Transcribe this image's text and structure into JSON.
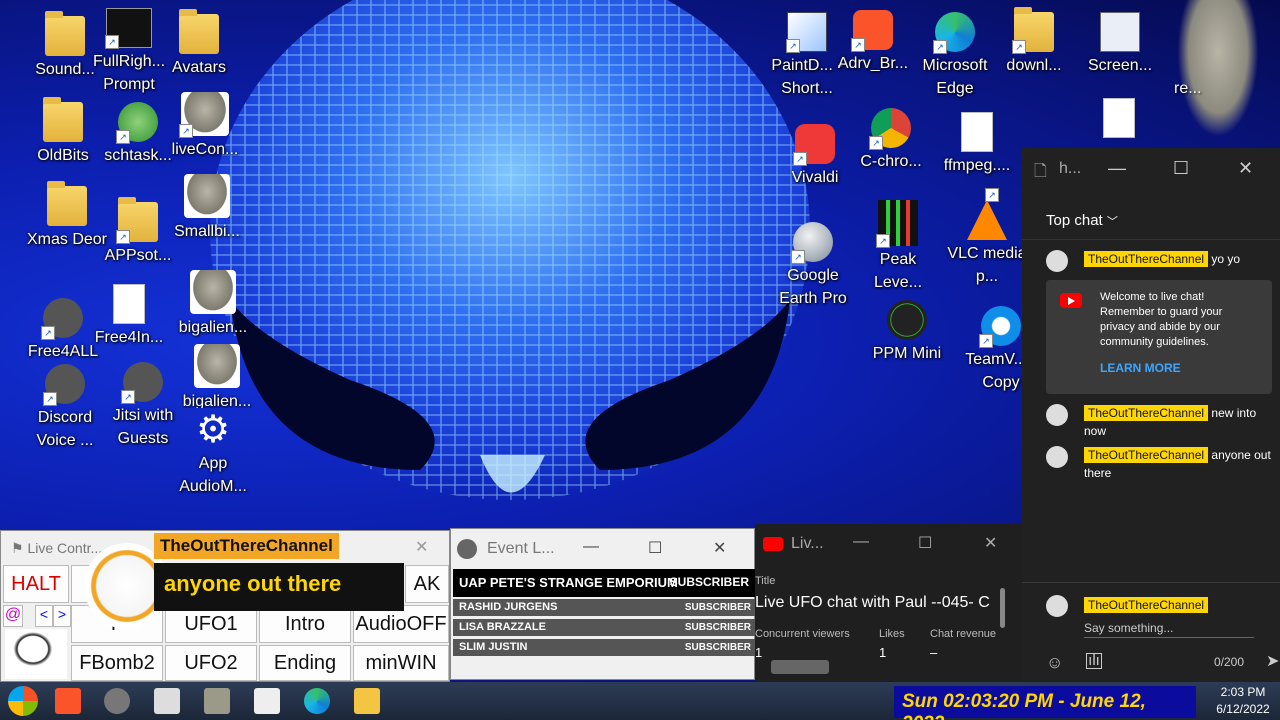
{
  "desktop_icons": [
    {
      "label": "Sound...",
      "icon": "folder-icon"
    },
    {
      "label": "FullRigh... Prompt",
      "icon": "command-prompt-icon"
    },
    {
      "label": "Avatars",
      "icon": "folder-icon"
    },
    {
      "label": "OldBits",
      "icon": "folder-icon"
    },
    {
      "label": "schtask...",
      "icon": "task-scheduler-icon"
    },
    {
      "label": "liveCon...",
      "icon": "alien-shield-icon"
    },
    {
      "label": "Xmas Deor",
      "icon": "folder-icon"
    },
    {
      "label": "APPsot...",
      "icon": "folder-icon"
    },
    {
      "label": "Smallbi...",
      "icon": "alien-image-icon"
    },
    {
      "label": "Free4ALL",
      "icon": "brave-link-icon"
    },
    {
      "label": "Free4In...",
      "icon": "file-icon"
    },
    {
      "label": "bigalien...",
      "icon": "alien-image-icon"
    },
    {
      "label": "Discord Voice ...",
      "icon": "brave-link-icon"
    },
    {
      "label": "Jitsi with Guests",
      "icon": "brave-link-icon"
    },
    {
      "label": "bigalien...",
      "icon": "alien-image-icon"
    },
    {
      "label": "App AudioM...",
      "icon": "gear-icon"
    },
    {
      "label": "PaintD... - Short...",
      "icon": "paint-icon"
    },
    {
      "label": "Adrv_Br...",
      "icon": "brave-icon"
    },
    {
      "label": "Microsoft Edge",
      "icon": "edge-icon"
    },
    {
      "label": "downl...",
      "icon": "folder-icon"
    },
    {
      "label": "Screen...",
      "icon": "screenshot-icon"
    },
    {
      "label": "re...",
      "icon": "alien-image-icon"
    },
    {
      "label": "Vivaldi",
      "icon": "vivaldi-icon"
    },
    {
      "label": "C-chro...",
      "icon": "chrome-icon"
    },
    {
      "label": "ffmpeg....",
      "icon": "file-icon"
    },
    {
      "label": "Google Earth Pro",
      "icon": "google-earth-icon"
    },
    {
      "label": "Peak Leve...",
      "icon": "peak-level-icon"
    },
    {
      "label": "VLC media p...",
      "icon": "vlc-icon"
    },
    {
      "label": "PPM Mini",
      "icon": "ppm-meter-icon"
    },
    {
      "label": "TeamV... - Copy",
      "icon": "teamviewer-icon"
    }
  ],
  "chat": {
    "window_title": "h...",
    "filter": "Top chat",
    "messages": [
      {
        "author": "TheOutThereChannel",
        "text": "yo yo"
      },
      {
        "author": "TheOutThereChannel",
        "text": "new into now"
      },
      {
        "author": "TheOutThereChannel",
        "text": "anyone out there"
      }
    ],
    "welcome_text": "Welcome to live chat! Remember to guard your privacy and abide by our community guidelines.",
    "learn_more": "LEARN MORE",
    "input_author": "TheOutThereChannel",
    "input_placeholder": "Say something...",
    "char_count": "0/200"
  },
  "live_control": {
    "title": "Live Contr...",
    "overlay_name": "TheOutThereChannel",
    "overlay_message": "anyone out there",
    "buttons": {
      "halt": "HALT",
      "ak": "AK",
      "at": "@",
      "left": "<",
      "right": ">",
      "f": "F",
      "ufo1": "UFO1",
      "intro": "Intro",
      "audiooff": "AudioOFF",
      "fbomb2": "FBomb2",
      "ufo2": "UFO2",
      "ending": "Ending",
      "minwin": "minWIN"
    }
  },
  "event_list": {
    "title": "Event L...",
    "header_name": "UAP PETE'S STRANGE EMPORIUM",
    "header_type": "SUBSCRIBER",
    "rows": [
      {
        "name": "RASHID JURGENS",
        "type": "SUBSCRIBER"
      },
      {
        "name": "LISA BRAZZALE",
        "type": "SUBSCRIBER"
      },
      {
        "name": "SLIM JUSTIN",
        "type": "SUBSCRIBER"
      }
    ]
  },
  "live_dashboard": {
    "title": "Liv...",
    "title_label": "Title",
    "stream_title": "Live UFO chat with Paul --045- C",
    "stats": [
      {
        "label": "Concurrent viewers",
        "value": "1"
      },
      {
        "label": "Likes",
        "value": "1"
      },
      {
        "label": "Chat revenue",
        "value": "–"
      }
    ]
  },
  "taskbar": {
    "banner_clock": "Sun 02:03:20 PM - June 12, 2022",
    "time": "2:03 PM",
    "date": "6/12/2022"
  },
  "colors": {
    "desktop_blue": "#0c1fb0",
    "chat_bg": "#212121",
    "author_badge": "#ffd600",
    "overlay_orange": "#f2a626",
    "clock_banner": "#0b0b9e",
    "youtube_red": "#ff0000",
    "link_blue": "#3ea6ff"
  }
}
